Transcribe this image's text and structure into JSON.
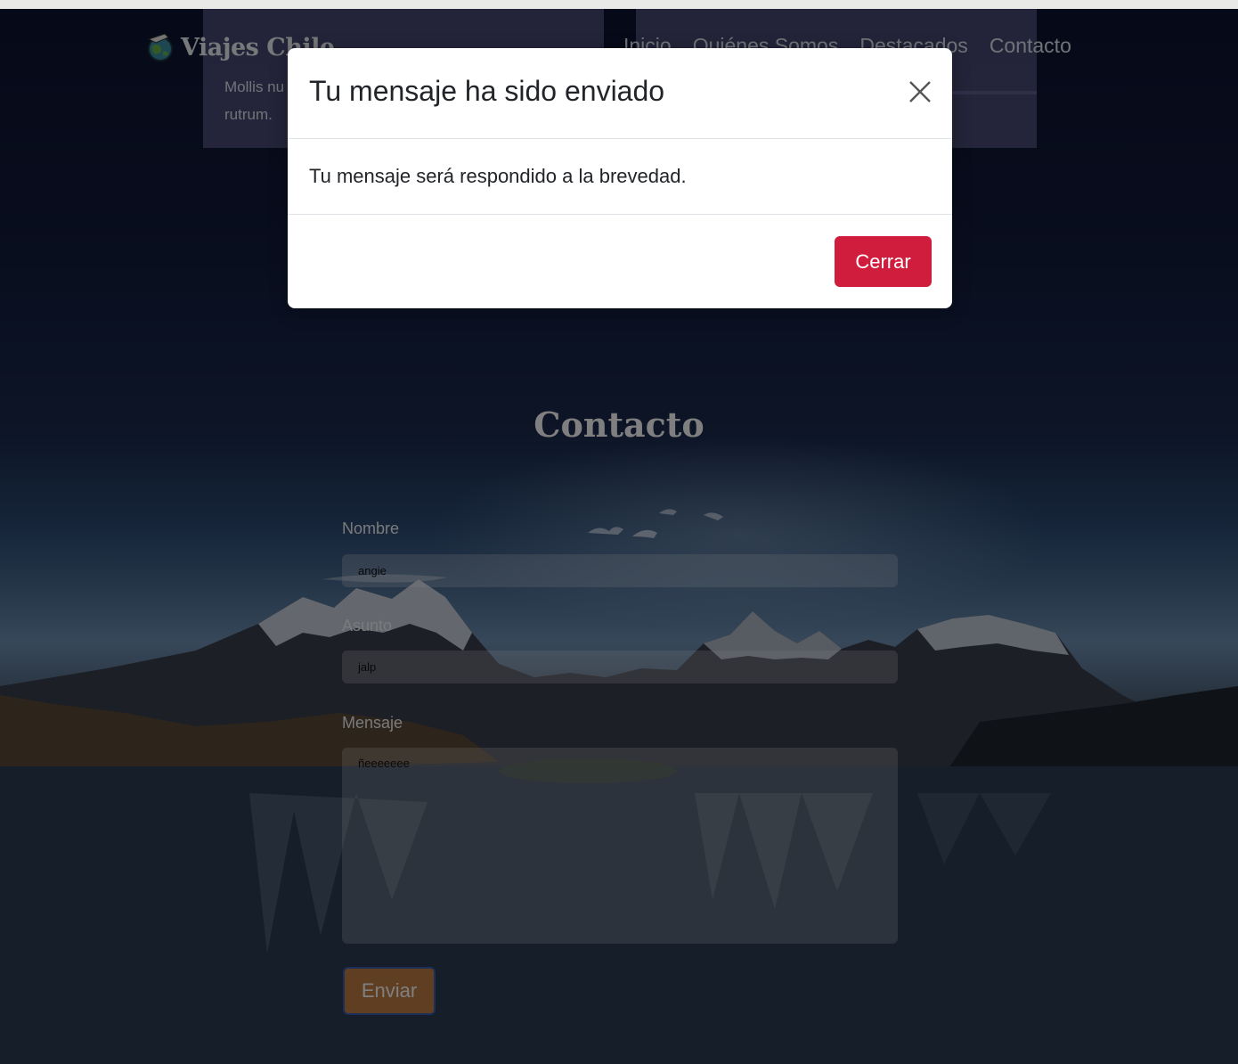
{
  "site": {
    "brand_name": "Viajes Chile",
    "nav_items": [
      {
        "label": "Inicio"
      },
      {
        "label": "Quiénes Somos"
      },
      {
        "label": "Destacados"
      },
      {
        "label": "Contacto"
      }
    ],
    "card_text_line1": "Mollis nu",
    "card_text_line2": "rutrum."
  },
  "contact": {
    "title": "Contacto",
    "fields": {
      "nombre": {
        "label": "Nombre",
        "value": "angie"
      },
      "asunto": {
        "label": "Asunto",
        "value": "jalp"
      },
      "mensaje": {
        "label": "Mensaje",
        "value": "ñeeeeeee"
      }
    },
    "submit_label": "Enviar"
  },
  "modal": {
    "title": "Tu mensaje ha sido enviado",
    "body": "Tu mensaje será respondido a la brevedad.",
    "close_label": "Cerrar",
    "close_icon": "close-icon"
  },
  "colors": {
    "primary_button": "#d11d3d",
    "submit_button": "#c07d45",
    "submit_border": "#3a5fb0"
  }
}
